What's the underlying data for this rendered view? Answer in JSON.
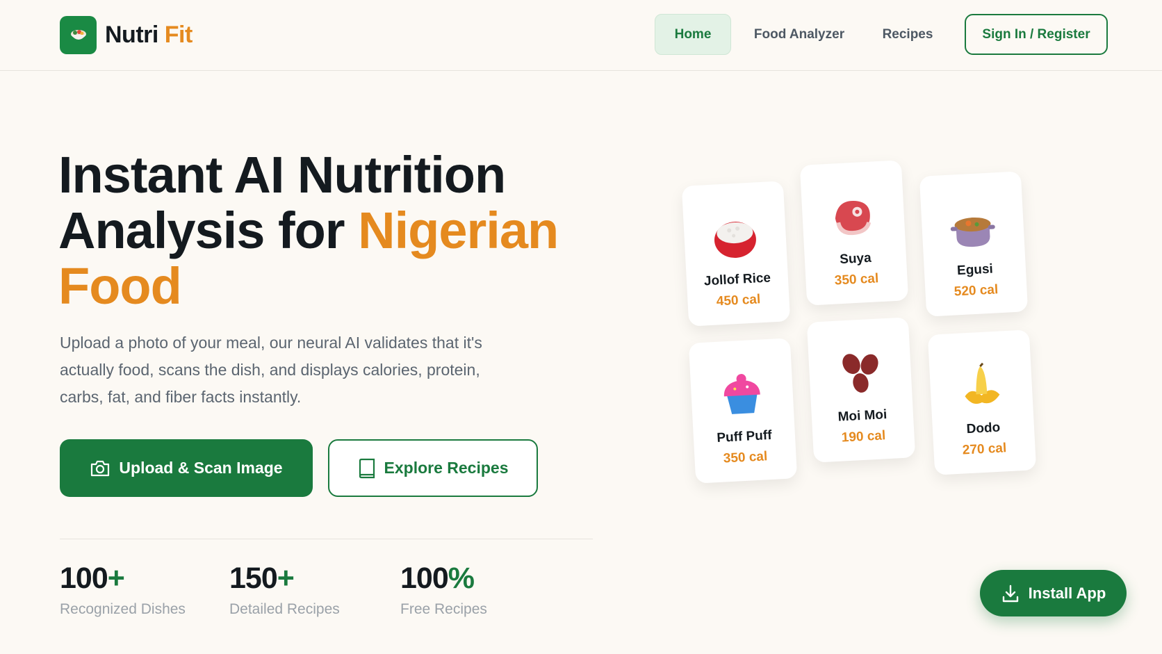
{
  "brand": {
    "name_part1": "Nutri",
    "name_part2": "Fit",
    "icon": "bowl-icon"
  },
  "nav": {
    "items": [
      {
        "label": "Home",
        "active": true
      },
      {
        "label": "Food Analyzer",
        "active": false
      },
      {
        "label": "Recipes",
        "active": false
      }
    ],
    "signin_label": "Sign In / Register"
  },
  "hero": {
    "title_line1": "Instant AI Nutrition",
    "title_line2_start": "Analysis for ",
    "title_line2_accent": "Nigerian",
    "title_line3_accent": "Food",
    "description": "Upload a photo of your meal, our neural AI validates that it's actually food, scans the dish, and displays calories, protein, carbs, fat, and fiber facts instantly.",
    "primary_button": "Upload & Scan Image",
    "secondary_button": "Explore Recipes"
  },
  "stats": [
    {
      "value": "100",
      "suffix": "+",
      "label": "Recognized Dishes"
    },
    {
      "value": "150",
      "suffix": "+",
      "label": "Detailed Recipes"
    },
    {
      "value": "100",
      "suffix": "%",
      "label": "Free Recipes"
    }
  ],
  "food_cards": [
    {
      "name": "Jollof Rice",
      "cal": "450 cal",
      "icon": "rice-bowl-icon"
    },
    {
      "name": "Suya",
      "cal": "350 cal",
      "icon": "meat-icon"
    },
    {
      "name": "Egusi",
      "cal": "520 cal",
      "icon": "soup-pot-icon"
    },
    {
      "name": "Puff Puff",
      "cal": "350 cal",
      "icon": "cupcake-icon"
    },
    {
      "name": "Moi Moi",
      "cal": "190 cal",
      "icon": "beans-icon"
    },
    {
      "name": "Dodo",
      "cal": "270 cal",
      "icon": "banana-icon"
    }
  ],
  "install_label": "Install App",
  "colors": {
    "brand_green": "#1a7a3e",
    "accent_orange": "#e58a1f",
    "background": "#fcf9f4"
  }
}
